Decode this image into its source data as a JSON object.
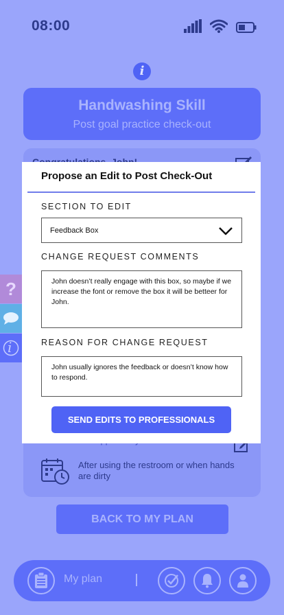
{
  "status_bar": {
    "time": "08:00",
    "icons": [
      "signal-icon",
      "wifi-icon",
      "battery-icon"
    ]
  },
  "info_icon": "i",
  "header": {
    "title": "Handwashing Skill",
    "subtitle": "Post goal practice check-out"
  },
  "background_card": {
    "congrats": "Congratulations, John!",
    "next_label": "Next scheduled opportunity:",
    "when_text": "After using the restroom or when hands are dirty"
  },
  "back_button": "BACK TO MY PLAN",
  "bottom_nav": {
    "my_plan_label": "My plan",
    "separator": "|"
  },
  "side_tabs": {
    "help": "?",
    "info": "i"
  },
  "modal": {
    "title": "Propose an Edit to Post Check-Out",
    "section_label": "SECTION TO EDIT",
    "section_value": "Feedback Box",
    "comments_label": "CHANGE REQUEST COMMENTS",
    "comments_value": "John doesn’t really engage with this box, so maybe if we increase the font or remove the box it will be betteer for John.",
    "reason_label": "REASON FOR CHANGE REQUEST",
    "reason_value": "John usually ignores the feedback or doesn’t know how to respond.",
    "send_button": "SEND EDITS TO PROFESSIONALS"
  },
  "colors": {
    "background": "#9aa5fb",
    "accent": "#4f63f5",
    "card": "#5d6ef9",
    "dark_text": "#2d3a8c"
  }
}
